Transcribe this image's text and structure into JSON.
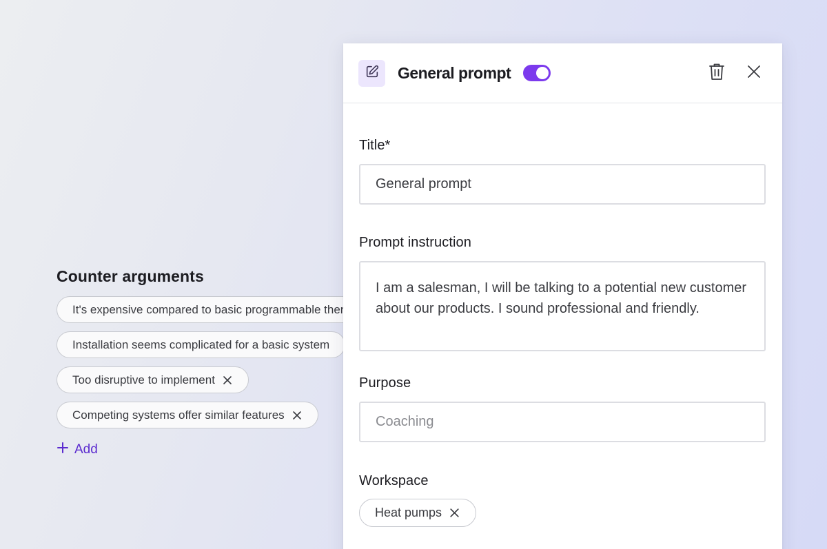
{
  "counter_arguments": {
    "title": "Counter arguments",
    "items": [
      "It's expensive compared to basic programmable thermostats",
      "Installation seems complicated for a basic system",
      "Too disruptive to implement",
      "Competing systems offer similar features"
    ],
    "add_label": "Add"
  },
  "panel": {
    "title": "General prompt",
    "toggle_on": true,
    "fields": {
      "title_label": "Title*",
      "title_value": "General prompt",
      "instruction_label": "Prompt instruction",
      "instruction_value": "I am a salesman, I will be talking to a potential new customer about our products. I sound professional and friendly.",
      "purpose_label": "Purpose",
      "purpose_placeholder": "Coaching",
      "workspace_label": "Workspace",
      "workspace_chip": "Heat pumps"
    }
  },
  "icons": {
    "edit": "pencil-square-icon",
    "delete": "trash-icon",
    "close": "close-icon",
    "remove": "x-icon",
    "add": "plus-icon"
  },
  "colors": {
    "accent": "#7c3aed",
    "link": "#5b2bcf",
    "edit_badge_bg": "#ece6fd"
  }
}
